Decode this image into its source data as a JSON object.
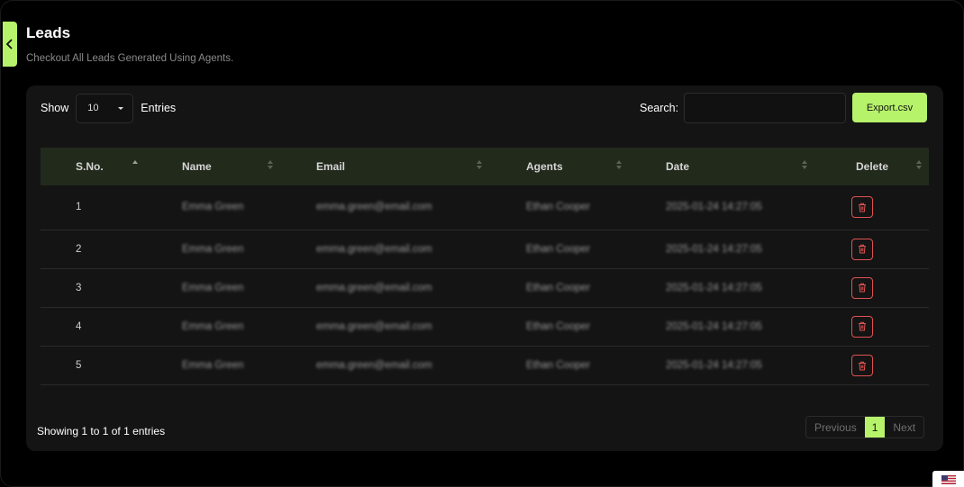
{
  "header": {
    "title": "Leads",
    "subtitle": "Checkout All Leads Generated Using Agents."
  },
  "controls": {
    "show_label": "Show",
    "page_size": "10",
    "entries_label": "Entries",
    "search_label": "Search:",
    "search_value": "",
    "export_label": "Export.csv"
  },
  "table": {
    "columns": [
      "S.No.",
      "Name",
      "Email",
      "Agents",
      "Date",
      "Delete"
    ],
    "rows": [
      {
        "sno": "1",
        "name": "Emma Green",
        "email": "emma.green@email.com",
        "agent": "Ethan Cooper",
        "date": "2025-01-24 14:27:05"
      },
      {
        "sno": "2",
        "name": "Emma Green",
        "email": "emma.green@email.com",
        "agent": "Ethan Cooper",
        "date": "2025-01-24 14:27:05"
      },
      {
        "sno": "3",
        "name": "Emma Green",
        "email": "emma.green@email.com",
        "agent": "Ethan Cooper",
        "date": "2025-01-24 14:27:05"
      },
      {
        "sno": "4",
        "name": "Emma Green",
        "email": "emma.green@email.com",
        "agent": "Ethan Cooper",
        "date": "2025-01-24 14:27:05"
      },
      {
        "sno": "5",
        "name": "Emma Green",
        "email": "emma.green@email.com",
        "agent": "Ethan Cooper",
        "date": "2025-01-24 14:27:05"
      }
    ]
  },
  "footer": {
    "info": "Showing 1 to 1 of 1 entries",
    "prev_label": "Previous",
    "current_page": "1",
    "next_label": "Next"
  },
  "icons": {
    "collapse": "chevron-left-icon",
    "delete": "trash-icon",
    "language": "us-flag-icon"
  },
  "colors": {
    "accent": "#b6f36a",
    "danger": "#e05252",
    "header_row": "#222a1c",
    "card": "#141414"
  }
}
